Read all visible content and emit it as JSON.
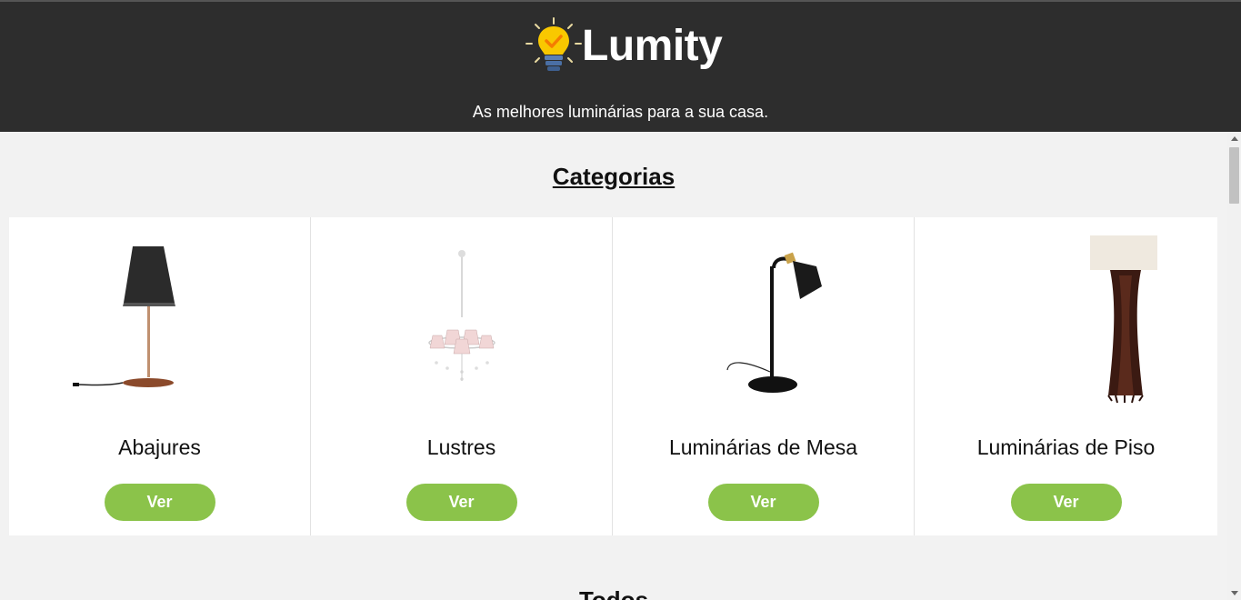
{
  "header": {
    "brand_name": "Lumity",
    "tagline": "As melhores luminárias para a sua casa.",
    "logo_icon": "lightbulb-check-icon",
    "colors": {
      "background": "#2d2d2d",
      "bulb": "#f9c800",
      "check": "#f57c00",
      "base": "#4a6fa5"
    }
  },
  "categories": {
    "title": "Categorias",
    "items": [
      {
        "name": "Abajures",
        "button": "Ver",
        "image": "table-lamp-image"
      },
      {
        "name": "Lustres",
        "button": "Ver",
        "image": "chandelier-image"
      },
      {
        "name": "Luminárias de Mesa",
        "button": "Ver",
        "image": "desk-lamp-image"
      },
      {
        "name": "Luminárias de Piso",
        "button": "Ver",
        "image": "floor-lamp-image"
      }
    ]
  },
  "all": {
    "title": "Todos"
  },
  "colors": {
    "accent": "#8bc34a",
    "page_background": "#f2f2f2"
  }
}
